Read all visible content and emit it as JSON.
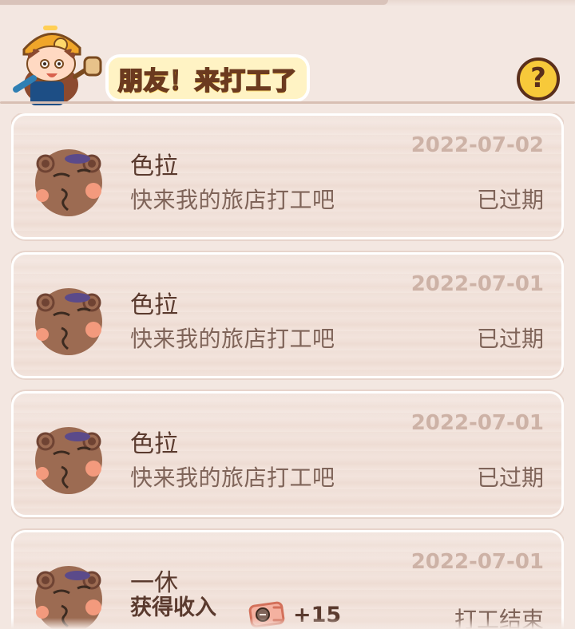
{
  "header": {
    "title": "朋友！来打工了",
    "help_symbol": "?"
  },
  "icons": {
    "mascot": "worker-girl-with-hammer-icon",
    "help": "question-icon",
    "avatar": "bear-avatar-icon",
    "reward": "coin-ticket-icon"
  },
  "colors": {
    "background": "#f3e7e1",
    "title_fill": "#f0b100",
    "title_stroke": "#6b3a1f",
    "help_fill": "#f7c93a",
    "text_primary": "#5a3a2e",
    "text_secondary": "#7f6459",
    "date": "#cdb2a6"
  },
  "cards": [
    {
      "name": "色拉",
      "message": "快来我的旅店打工吧",
      "date": "2022-07-02",
      "status": "已过期"
    },
    {
      "name": "色拉",
      "message": "快来我的旅店打工吧",
      "date": "2022-07-01",
      "status": "已过期"
    },
    {
      "name": "色拉",
      "message": "快来我的旅店打工吧",
      "date": "2022-07-01",
      "status": "已过期"
    },
    {
      "name": "一休",
      "income_label": "获得收入",
      "reward": "+15",
      "date": "2022-07-01",
      "status": "打工结束"
    }
  ]
}
